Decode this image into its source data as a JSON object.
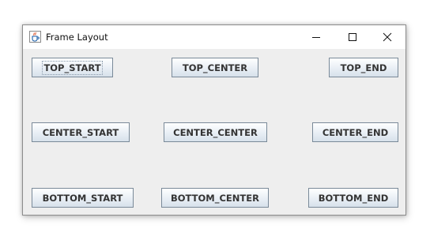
{
  "window": {
    "title": "Frame Layout",
    "app_icon": "java-cup-icon",
    "controls": {
      "minimize": "minimize-icon",
      "maximize": "maximize-icon",
      "close": "close-icon"
    }
  },
  "buttons": {
    "top_start": "TOP_START",
    "top_center": "TOP_CENTER",
    "top_end": "TOP_END",
    "center_start": "CENTER_START",
    "center_center": "CENTER_CENTER",
    "center_end": "CENTER_END",
    "bottom_start": "BOTTOM_START",
    "bottom_center": "BOTTOM_CENTER",
    "bottom_end": "BOTTOM_END"
  },
  "focused_button": "TOP_START",
  "colors": {
    "content_background": "#eeeeee",
    "button_border": "#7a8a99",
    "button_text": "#333333"
  }
}
